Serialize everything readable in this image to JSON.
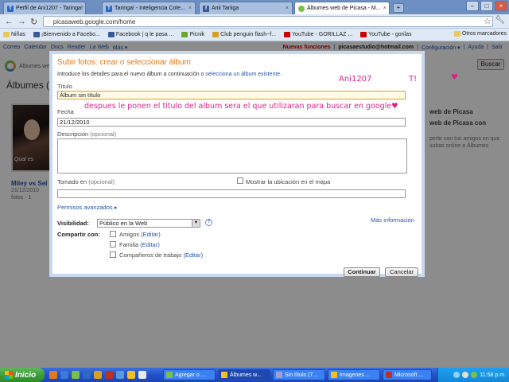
{
  "tabs": [
    {
      "label": "Perfil de Ani1207 - Taringa!",
      "color": "#2a6ac0",
      "glyph": "T"
    },
    {
      "label": "Taringa! - Inteligencia Cole...",
      "color": "#2a6ac0",
      "glyph": "T"
    },
    {
      "label": "Anii Tariiɡa",
      "color": "#3b5998",
      "glyph": "f"
    },
    {
      "label": "Álbumes web de Picasa - M...",
      "color": "#7bbf4a",
      "glyph": "",
      "active": true
    }
  ],
  "address": {
    "url": "picasaweb.google.com/home"
  },
  "bookmarks": [
    {
      "label": "Niñas",
      "color": "#e8c85a"
    },
    {
      "label": "¡Bienvenido a Facebo...",
      "color": "#3b5998"
    },
    {
      "label": "Facebook | q le pasa ...",
      "color": "#3b5998"
    },
    {
      "label": "Picnik",
      "color": "#6aa82e"
    },
    {
      "label": "Club penguin flash~f...",
      "color": "#d8a020"
    },
    {
      "label": "YouTube - GORILLAZ ...",
      "color": "#c00"
    },
    {
      "label": "YouTube - gorilas",
      "color": "#c00"
    }
  ],
  "bookmarks_other": "Otros marcadores",
  "topnav": [
    "Correo",
    "Calendar",
    "Docs",
    "Reader",
    "La Web",
    "Más ▾"
  ],
  "topright": {
    "novedades": "Nuevas funciones",
    "email": "picasaestudio@hotmail.com",
    "config": "Configuración ▾",
    "help": "Ayuda",
    "exit": "Salir"
  },
  "logo_text": "Álbumes web",
  "search_button": "Buscar",
  "albums_title": "Álbumes (2",
  "album": {
    "caption": "Qual es",
    "name": "Miley vs Sel",
    "date": "21/12/2010",
    "count": "fotos · 1"
  },
  "side": {
    "title1": "web de Picasa",
    "title2": "web de Picasa con",
    "text": "perte con tus amigos en que subas online a Álbumes"
  },
  "dialog": {
    "title": "Subir fotos: crear o seleccionar álbum",
    "intro_prefix": "Introduce los detalles para el nuevo álbum a continuación o ",
    "intro_link": "selecciona un álbum existente",
    "intro_suffix": ".",
    "title_label": "Título",
    "title_value": "Álbum sin título",
    "date_label": "Fecha",
    "date_value": "21/12/2010",
    "desc_label": "Descripción",
    "optional": "(opcional)",
    "location_label": "Tomado en",
    "map_checkbox": "Mostrar la ubicación en el mapa",
    "advanced": "Permisos avanzados ▸",
    "visibility_label": "Visibilidad:",
    "visibility_value": "Público en la Web",
    "more_info": "Más información",
    "share_label": "Compartir con:",
    "share_options": [
      {
        "label": "Amigos",
        "edit": "(Editar)"
      },
      {
        "label": "Familia",
        "edit": "(Editar)"
      },
      {
        "label": "Compañeros de trabajo",
        "edit": "(Editar)"
      }
    ],
    "continue": "Continuar",
    "cancel": "Cancelar"
  },
  "annotations": {
    "name": "Ani1207",
    "tag": "T!",
    "heart": "♥",
    "note": "despues le ponen el titulo del album sera el que utilizaran para buscar en google♥"
  },
  "taskbar": {
    "start": "Inicio",
    "tasks": [
      {
        "label": "Agregar o ...",
        "color": "#7bbf4a"
      },
      {
        "label": "Álbumes w...",
        "color": "#f0c020",
        "active": true
      },
      {
        "label": "Sin título (7...",
        "color": "#a0a0d0"
      },
      {
        "label": "Imagenes ...",
        "color": "#f0c020"
      },
      {
        "label": "Microsoft ...",
        "color": "#c03020"
      }
    ],
    "clock": "11:58 p.m."
  }
}
